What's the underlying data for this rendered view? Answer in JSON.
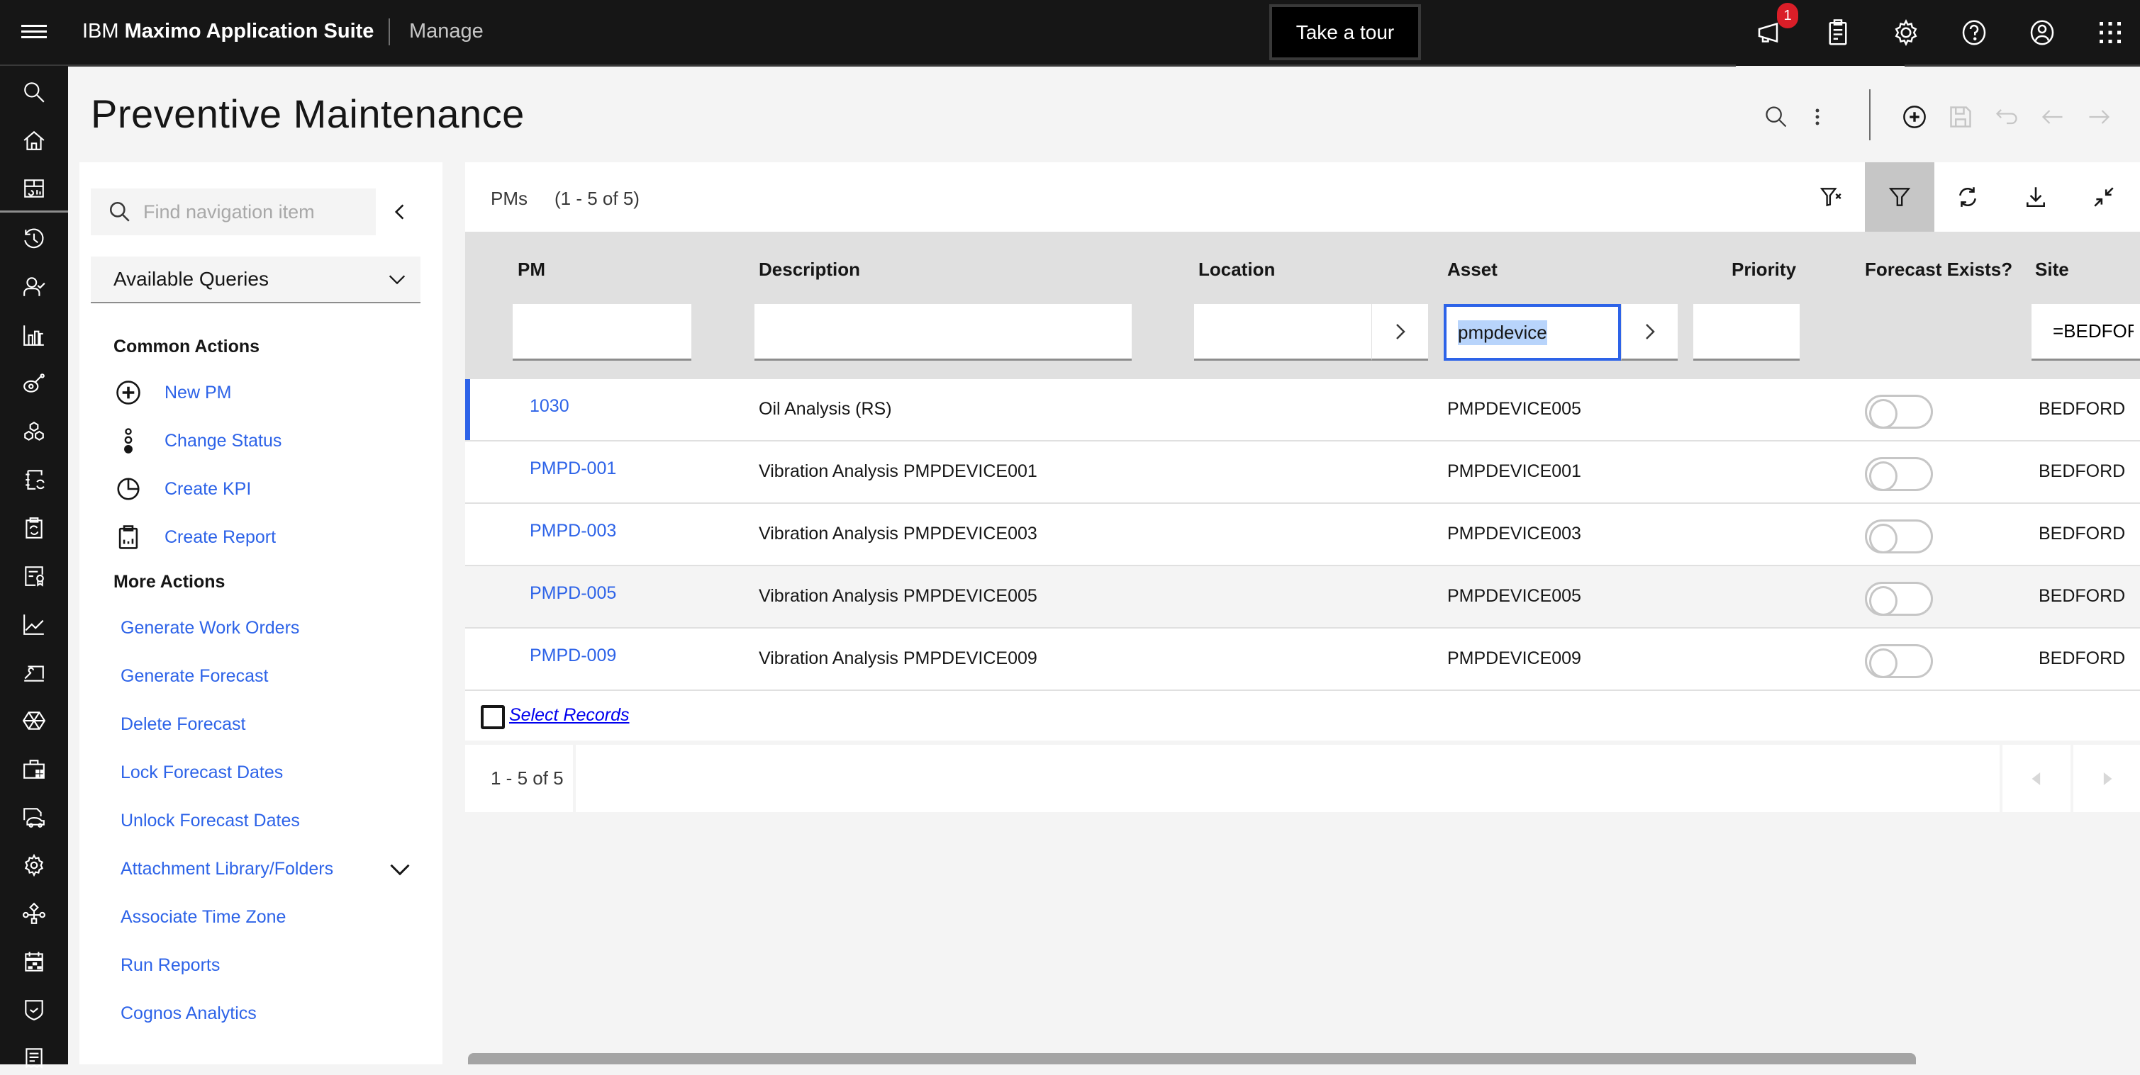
{
  "header": {
    "brand_prefix": "IBM",
    "brand_name": "Maximo Application Suite",
    "app_name": "Manage",
    "tour_button": "Take a tour",
    "notification_count": "1",
    "icons": [
      "megaphone-icon",
      "clipboard-icon",
      "settings-icon",
      "help-icon",
      "user-icon",
      "app-switcher-icon"
    ]
  },
  "rail": {
    "items": [
      "search",
      "home",
      "dashboard",
      "history",
      "user-check",
      "bar-chart",
      "meter",
      "cubes",
      "notebook-refresh",
      "clipboard-refresh",
      "certificate",
      "line-chart",
      "tools-laptop",
      "hexagon",
      "toolkit",
      "truck-car",
      "settings",
      "workflow",
      "calendar",
      "shield-check",
      "receipt"
    ]
  },
  "page": {
    "title": "Preventive Maintenance"
  },
  "nav": {
    "search_placeholder": "Find navigation item",
    "queries_label": "Available Queries",
    "common_actions_heading": "Common Actions",
    "common_actions": [
      {
        "label": "New PM",
        "icon": "add-circle-icon"
      },
      {
        "label": "Change Status",
        "icon": "status-icon"
      },
      {
        "label": "Create KPI",
        "icon": "pie-chart-icon"
      },
      {
        "label": "Create Report",
        "icon": "report-icon"
      }
    ],
    "more_actions_heading": "More Actions",
    "more_actions": [
      "Generate Work Orders",
      "Generate Forecast",
      "Delete Forecast",
      "Lock Forecast Dates",
      "Unlock Forecast Dates",
      "Attachment Library/Folders",
      "Associate Time Zone",
      "Run Reports",
      "Cognos Analytics"
    ]
  },
  "table": {
    "title": "PMs",
    "count": "(1 - 5 of 5)",
    "columns": [
      "PM",
      "Description",
      "Location",
      "Asset",
      "Priority",
      "Forecast Exists?",
      "Site"
    ],
    "filters": {
      "pm": "",
      "description": "",
      "location": "",
      "asset": "pmpdevice",
      "priority": "",
      "site": "=BEDFORD"
    },
    "rows": [
      {
        "pm": "1030",
        "description": "Oil Analysis (RS)",
        "location": "",
        "asset": "PMPDEVICE005",
        "priority": "",
        "forecast": false,
        "site": "BEDFORD"
      },
      {
        "pm": "PMPD-001",
        "description": "Vibration Analysis PMPDEVICE001",
        "location": "",
        "asset": "PMPDEVICE001",
        "priority": "",
        "forecast": false,
        "site": "BEDFORD"
      },
      {
        "pm": "PMPD-003",
        "description": "Vibration Analysis PMPDEVICE003",
        "location": "",
        "asset": "PMPDEVICE003",
        "priority": "",
        "forecast": false,
        "site": "BEDFORD"
      },
      {
        "pm": "PMPD-005",
        "description": "Vibration Analysis PMPDEVICE005",
        "location": "",
        "asset": "PMPDEVICE005",
        "priority": "",
        "forecast": false,
        "site": "BEDFORD"
      },
      {
        "pm": "PMPD-009",
        "description": "Vibration Analysis PMPDEVICE009",
        "location": "",
        "asset": "PMPDEVICE009",
        "priority": "",
        "forecast": false,
        "site": "BEDFORD"
      }
    ],
    "select_records": "Select Records",
    "pager_text": "1 - 5 of 5"
  },
  "colors": {
    "accent": "#2d63e8",
    "header_bg": "#161616",
    "badge": "#da1e28"
  }
}
